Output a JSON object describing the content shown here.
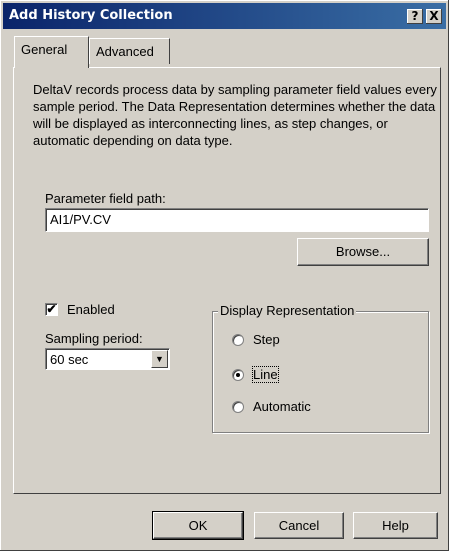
{
  "window": {
    "title": "Add History Collection",
    "help_label": "?",
    "close_label": "X"
  },
  "tabs": [
    {
      "label": "General"
    },
    {
      "label": "Advanced"
    }
  ],
  "description": "DeltaV records process data by sampling parameter field values every sample period. The Data Representation determines whether the data will be displayed as interconnecting lines, as step changes, or automatic depending on data type.",
  "parameter": {
    "label": "Parameter field path:",
    "value": "AI1/PV.CV",
    "browse_label": "Browse..."
  },
  "enabled": {
    "label": "Enabled",
    "checked": true
  },
  "sampling": {
    "label": "Sampling period:",
    "value": "60 sec"
  },
  "display": {
    "legend": "Display Representation",
    "options": [
      {
        "label": "Step",
        "selected": false
      },
      {
        "label": "Line",
        "selected": true
      },
      {
        "label": "Automatic",
        "selected": false
      }
    ]
  },
  "buttons": {
    "ok": "OK",
    "cancel": "Cancel",
    "help": "Help"
  },
  "glyphs": {
    "check": "✔",
    "dropdown_arrow": "▼"
  }
}
